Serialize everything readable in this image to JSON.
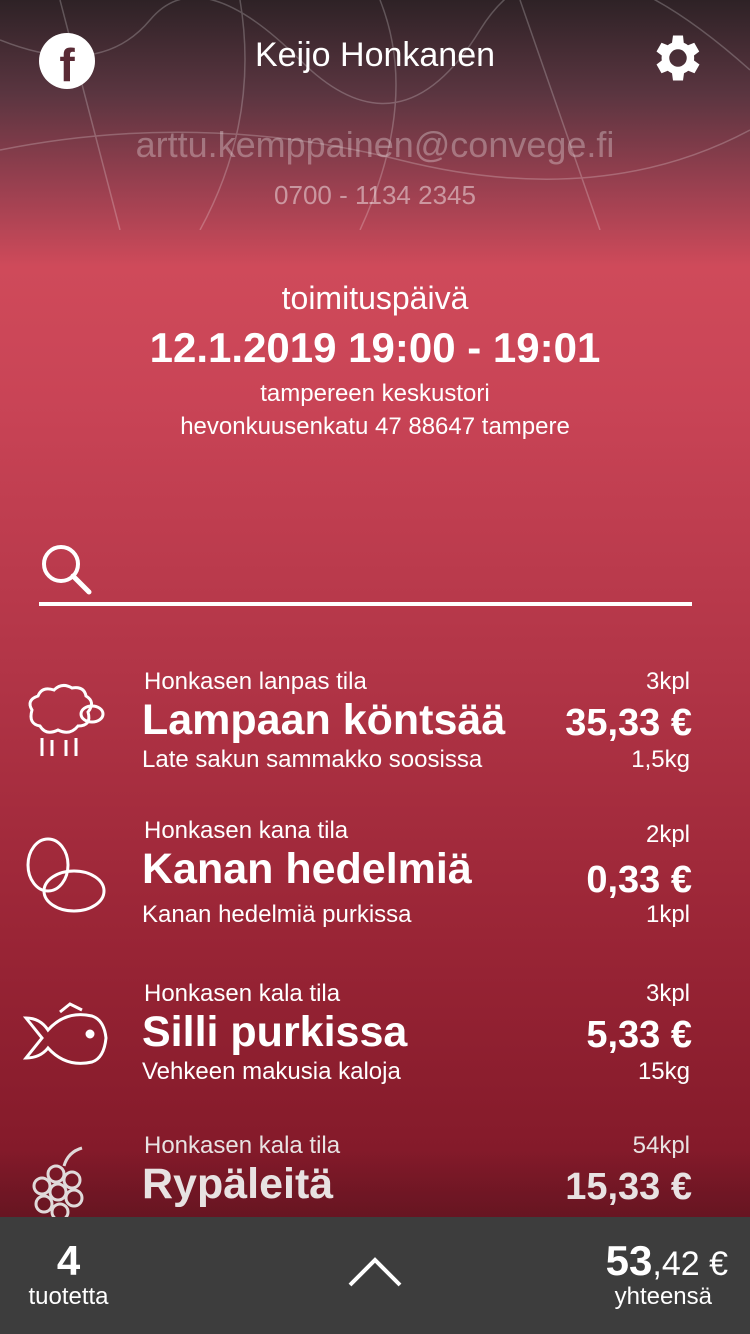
{
  "header": {
    "user_name": "Keijo Honkanen",
    "email": "arttu.kemppainen@convege.fi",
    "phone": "0700 - 1134 2345"
  },
  "delivery": {
    "label": "toimituspäivä",
    "datetime": "12.1.2019 19:00 - 19:01",
    "place": "tampereen keskustori",
    "address": "hevonkuusenkatu 47 88647 tampere"
  },
  "search": {
    "placeholder": ""
  },
  "items": [
    {
      "farm": "Honkasen lanpas tila",
      "name": "Lampaan köntsää",
      "desc": "Late sakun sammakko soosissa",
      "qty": "3kpl",
      "price": "35,33 €",
      "weight": "1,5kg",
      "icon": "sheep-icon"
    },
    {
      "farm": "Honkasen kana tila",
      "name": "Kanan hedelmiä",
      "desc": "Kanan hedelmiä purkissa",
      "qty": "2kpl",
      "price": "0,33 €",
      "weight": "1kpl",
      "icon": "eggs-icon"
    },
    {
      "farm": "Honkasen kala tila",
      "name": "Silli purkissa",
      "desc": "Vehkeen makusia kaloja",
      "qty": "3kpl",
      "price": "5,33 €",
      "weight": "15kg",
      "icon": "fish-icon"
    },
    {
      "farm": "Honkasen kala tila",
      "name": "Rypäleitä",
      "qty": "54kpl",
      "price": "15,33 €",
      "icon": "grapes-icon"
    }
  ],
  "footer": {
    "count": "4",
    "count_label": "tuotetta",
    "total_main": "53",
    "total_rest": ",42 €",
    "total_label": "yhteensä"
  },
  "colors": {
    "footer_bg": "#3d3d3d",
    "accent": "#cf4a5a"
  }
}
